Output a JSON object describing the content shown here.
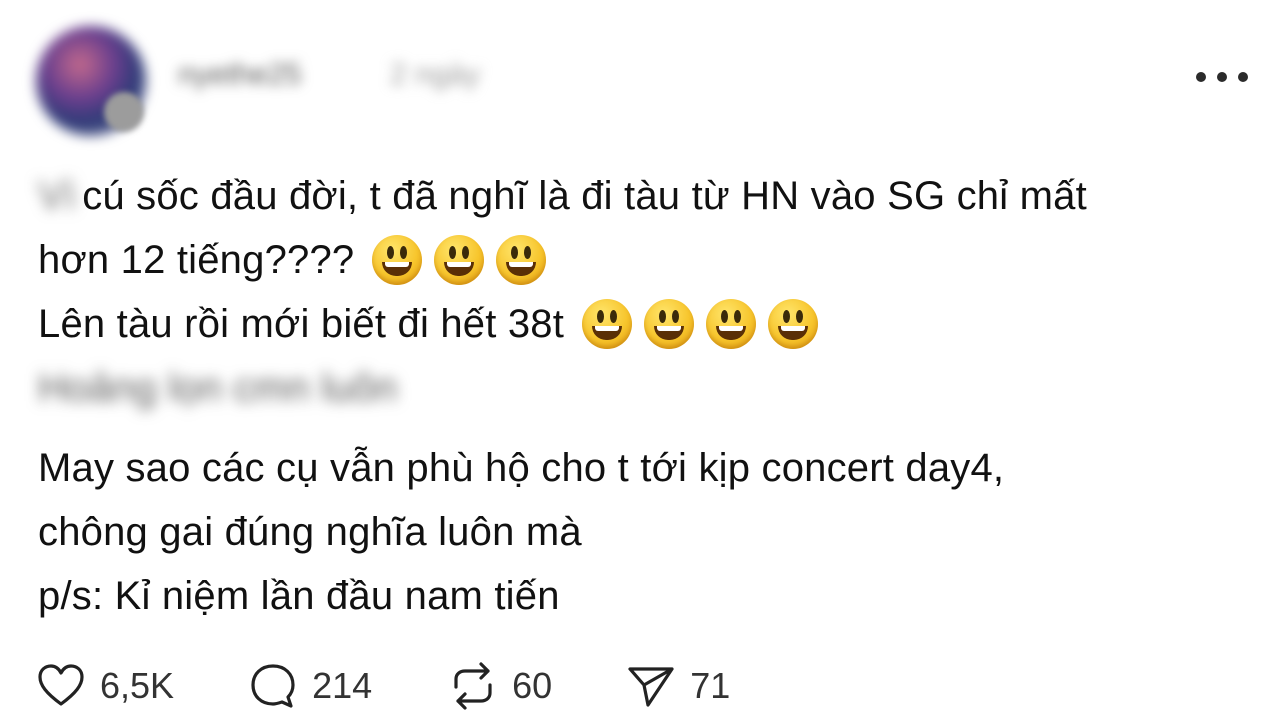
{
  "post": {
    "author": {
      "username": "nyethe25",
      "timestamp": "2 ngày"
    },
    "body": {
      "line1_prefix": "Vì",
      "line1": "cú sốc đầu đời, t đã nghĩ là đi tàu từ HN vào SG chỉ mất",
      "line2": "hơn 12 tiếng????",
      "line3": "Lên tàu rồi mới biết đi hết 38t",
      "line4_blurred": "Hoảng lọn cmn luôn",
      "line5": "May sao các cụ vẫn phù hộ cho t tới kịp concert day4,",
      "line6": "chông gai đúng nghĩa luôn mà",
      "line7": "p/s: Kỉ niệm lần đầu nam tiến"
    },
    "emoji_icon": "grinning-face-emoji"
  },
  "actions": {
    "likes": "6,5K",
    "replies": "214",
    "reposts": "60",
    "shares": "71"
  }
}
